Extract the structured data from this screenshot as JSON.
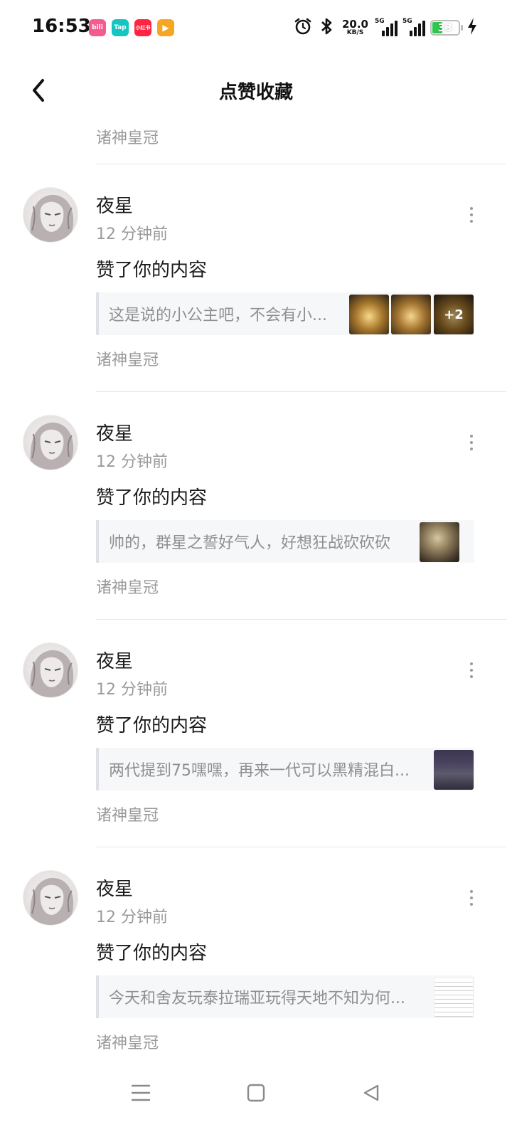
{
  "status_bar": {
    "time": "16:53",
    "apps": [
      {
        "name": "bilibili",
        "label": "bili",
        "color": "#f25d8e"
      },
      {
        "name": "taptap",
        "label": "Tap",
        "color": "#14c5c2"
      },
      {
        "name": "xiaohongshu",
        "label": "小红书",
        "color": "#ff2442"
      },
      {
        "name": "video",
        "label": "▶",
        "color": "#f5a623"
      }
    ],
    "net_speed_value": "20.0",
    "net_speed_unit": "KB/S",
    "signal_1_tag": "5G",
    "signal_2_tag": "5G",
    "battery": "33",
    "battery_color": "#2dc84d"
  },
  "header": {
    "title": "点赞收藏"
  },
  "top_partial": {
    "source": "诸神皇冠"
  },
  "items": [
    {
      "user": "夜星",
      "time": "12 分钟前",
      "action": "赞了你的内容",
      "quote": "这是说的小公主吧，不会有小...",
      "thumb_more": "+2",
      "source": "诸神皇冠"
    },
    {
      "user": "夜星",
      "time": "12 分钟前",
      "action": "赞了你的内容",
      "quote": "帅的，群星之誓好气人，好想狂战砍砍砍",
      "source": "诸神皇冠"
    },
    {
      "user": "夜星",
      "time": "12 分钟前",
      "action": "赞了你的内容",
      "quote": "两代提到75嘿嘿，再来一代可以黑精混白...",
      "source": "诸神皇冠"
    },
    {
      "user": "夜星",
      "time": "12 分钟前",
      "action": "赞了你的内容",
      "quote": "今天和舍友玩泰拉瑞亚玩得天地不知为何...",
      "source": "诸神皇冠"
    }
  ],
  "nav_icons": [
    "menu-icon",
    "home-square-icon",
    "back-triangle-icon"
  ]
}
